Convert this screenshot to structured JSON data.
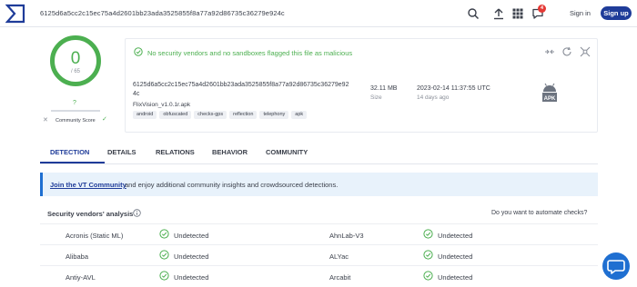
{
  "search": {
    "value": "6125d6a5cc2c15ec75a4d2601bb23ada3525855f8a77a92d86735c36279e924c"
  },
  "header": {
    "notification_count": "4",
    "signin_label": "Sign in",
    "signup_label": "Sign up"
  },
  "score": {
    "value": "0",
    "total": "/ 65",
    "community_value": "?",
    "community_label": "Community Score"
  },
  "banner": {
    "text": "No security vendors and no sandboxes flagged this file as malicious"
  },
  "file": {
    "hash": "6125d6a5cc2c15ec75a4d2601bb23ada3525855f8a77a92d86735c36279e924c",
    "name": "FlixVision_v1.0.1r.apk",
    "tags": [
      "android",
      "obfuscated",
      "checks-gps",
      "reflection",
      "telephony",
      "apk"
    ],
    "size": "32.11 MB",
    "size_label": "Size",
    "date": "2023-02-14 11:37:55 UTC",
    "date_ago": "14 days ago",
    "type_icon_label": "APK"
  },
  "tabs": [
    "DETECTION",
    "DETAILS",
    "RELATIONS",
    "BEHAVIOR",
    "COMMUNITY"
  ],
  "community_banner": {
    "link": "Join the VT Community",
    "text": "and enjoy additional community insights and crowdsourced detections."
  },
  "vendors_section": {
    "title": "Security vendors' analysis",
    "automate": "Do you want to automate checks?",
    "rows": [
      {
        "left": {
          "name": "Acronis (Static ML)",
          "result": "Undetected"
        },
        "right": {
          "name": "AhnLab-V3",
          "result": "Undetected"
        }
      },
      {
        "left": {
          "name": "Alibaba",
          "result": "Undetected"
        },
        "right": {
          "name": "ALYac",
          "result": "Undetected"
        }
      },
      {
        "left": {
          "name": "Antiy-AVL",
          "result": "Undetected"
        },
        "right": {
          "name": "Arcabit",
          "result": "Undetected"
        }
      }
    ]
  },
  "colors": {
    "accent": "#1f3c99",
    "clean": "#4caf50",
    "alert": "#e53935",
    "chat": "#1f6fd1"
  }
}
